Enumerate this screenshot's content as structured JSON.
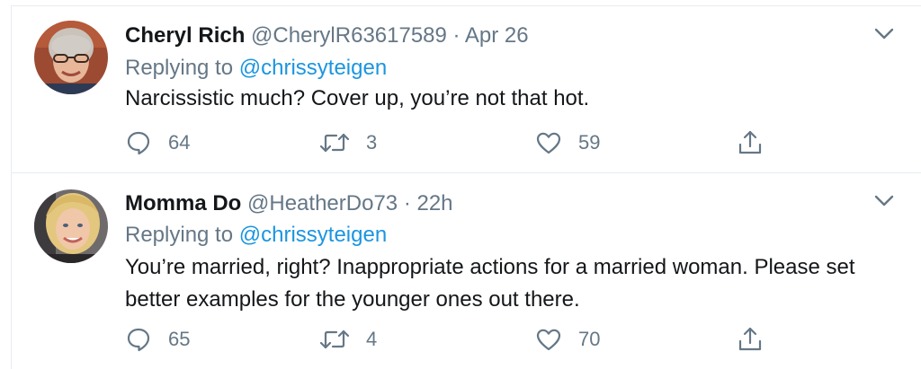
{
  "tweets": [
    {
      "name": "Cheryl Rich",
      "handle": "@CherylR63617589",
      "separator": "·",
      "time": "Apr 26",
      "replying_prefix": "Replying to",
      "replying_to": "@chrissyteigen",
      "text": "Narcissistic much? Cover up, you’re not that hot.",
      "replies": "64",
      "retweets": "3",
      "likes": "59",
      "icons": {
        "reply": "reply-icon",
        "retweet": "retweet-icon",
        "like": "like-icon",
        "share": "share-icon",
        "menu": "chevron-down-icon"
      }
    },
    {
      "name": "Momma Do",
      "handle": "@HeatherDo73",
      "separator": "·",
      "time": "22h",
      "replying_prefix": "Replying to",
      "replying_to": "@chrissyteigen",
      "text": "You’re married, right? Inappropriate actions for a married woman. Please set better examples for the younger ones out there.",
      "replies": "65",
      "retweets": "4",
      "likes": "70",
      "icons": {
        "reply": "reply-icon",
        "retweet": "retweet-icon",
        "like": "like-icon",
        "share": "share-icon",
        "menu": "chevron-down-icon"
      }
    }
  ],
  "colors": {
    "text": "#14171a",
    "secondary": "#657786",
    "link": "#1b95e0",
    "divider": "#e6ecf0"
  }
}
